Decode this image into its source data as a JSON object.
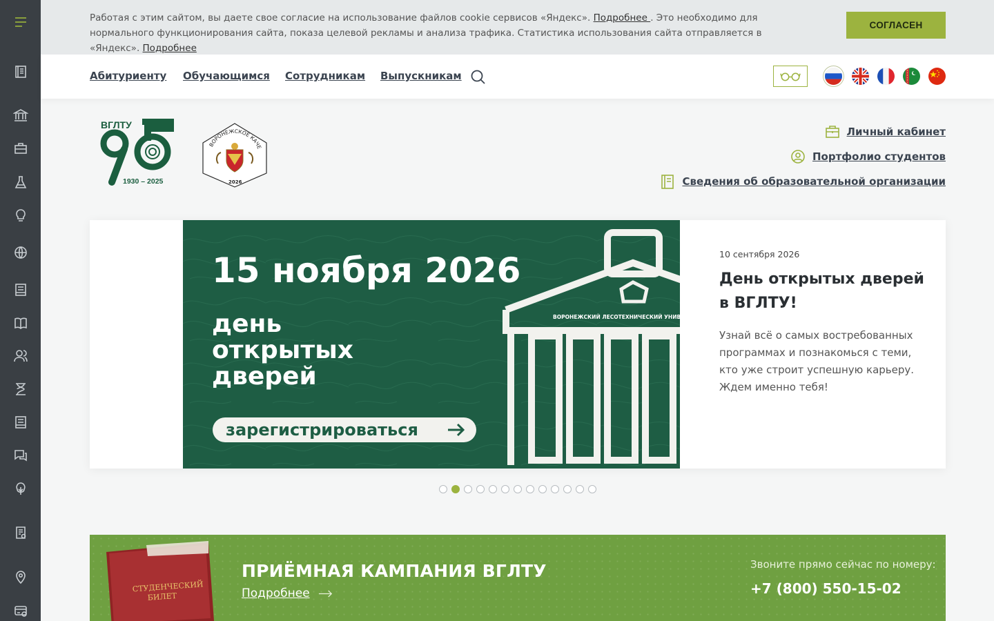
{
  "cookie": {
    "text_1": "Работая с этим сайтом, вы даете свое согласие на использование файлов cookie сервисов «Яндекс». ",
    "link_1": "Подробнее ",
    "text_2": ". Это необходимо для нормального функционирования сайта, показа целевой рекламы и анализа трафика. Статистика использования сайта отправляется в «Яндекс». ",
    "link_2": "Подробнее",
    "agree_label": "СОГЛАСЕН"
  },
  "nav": {
    "items": [
      "Абитуриенту",
      "Обучающимся",
      "Сотрудникам",
      "Выпускникам"
    ]
  },
  "languages": [
    "ru",
    "en",
    "fr",
    "tm",
    "cn"
  ],
  "header_links": {
    "cabinet": "Личный кабинет",
    "portfolio": "Портфолио студентов",
    "info": "Сведения об образовательной организации"
  },
  "logos": {
    "anniversary_name": "ВГЛТУ",
    "anniversary_years": "1930 – 2025",
    "seal_text": "ВОРОНЕЖСКОЕ КАЧЕСТВО",
    "seal_year": "2026"
  },
  "slide": {
    "banner_date": "15 ноября 2026",
    "banner_line1": "день",
    "banner_line2": "открытых",
    "banner_line3": "дверей",
    "banner_button": "зарегистрироваться",
    "building_caption": "ВОРОНЕЖСКИЙ ЛЕСОТЕХНИЧЕСКИЙ УНИВЕР",
    "date": "10 сентября 2026",
    "title": "День открытых дверей в ВГЛТУ!",
    "description": "Узнай всё о самых востребованных программах и познакомься с теми, кто уже строит успешную карьеру. Ждем именно тебя!"
  },
  "slider": {
    "count": 13,
    "active": 2
  },
  "admission": {
    "title": "ПРИЁМНАЯ КАМПАНИЯ ВГЛТУ",
    "more": "Подробнее",
    "call_text": "Звоните прямо сейчас по номеру:",
    "phone": "+7 (800) 550-15-02",
    "ticket_text_1": "СТУДЕНЧЕСКИЙ",
    "ticket_text_2": "БИЛЕТ"
  },
  "colors": {
    "accent": "#9cb33f",
    "sidebar": "#3a3f44",
    "banner_green": "#1e5d44",
    "admission_green": "#6fa041"
  }
}
